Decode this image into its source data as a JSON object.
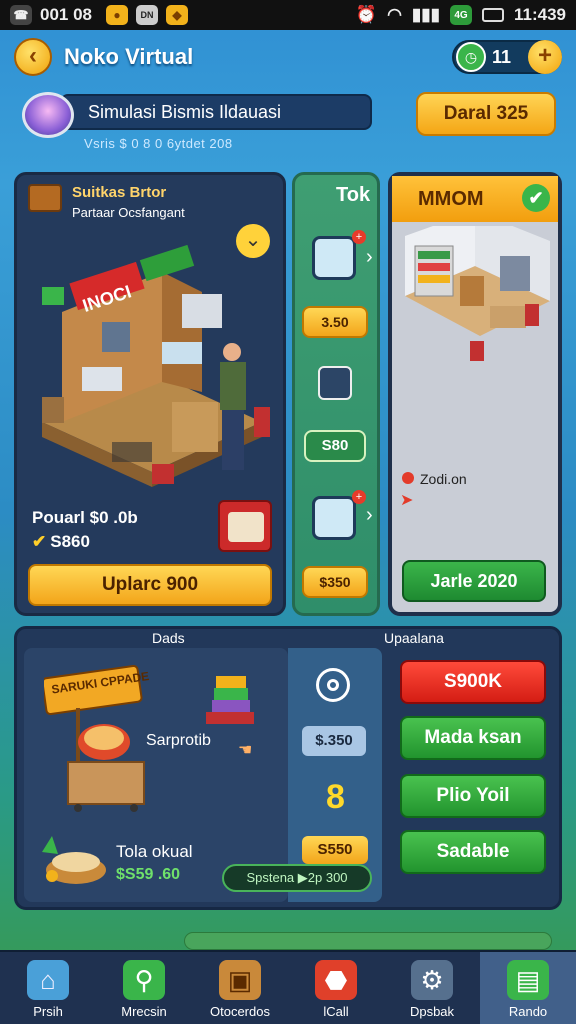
{
  "status_bar": {
    "time_left": "001 08",
    "time_right": "11:439",
    "signal": "4G"
  },
  "header": {
    "title": "Noko Virtual",
    "coin_value": "11",
    "back_glyph": "‹",
    "plus_glyph": "+"
  },
  "subheader": {
    "title": "Simulasi Bismis Ildauasi",
    "subtitle": "Vsris $ 0 8 0 6ytdet 208",
    "button": "Daral 325"
  },
  "panel_left": {
    "title": "Suitkas Brtor",
    "subtitle": "Partaar Ocsfangant",
    "store_sign": "INOCI",
    "price_label": "Pouarl $0 .0b",
    "check_value": "S860",
    "upgrade_button": "Uplarc 900"
  },
  "panel_mid": {
    "title": "Tok",
    "price_1": "3.50",
    "chip": "S80",
    "price_2": "$350"
  },
  "panel_right": {
    "header": "MMOM",
    "note": "Zodi.on",
    "button": "Jarle 2020"
  },
  "lower": {
    "left_label": "Dads",
    "right_label": "Upaalana",
    "cart_sign": "SARUKI CPPADE",
    "item_label": "Sarprotib",
    "total_label": "Tola okual",
    "total_value": "$S59 .60",
    "system_pill": "Spstena ▶2p 300",
    "price_small": "$.350",
    "counter": "8",
    "price_gold": "S550",
    "buttons": [
      "S900K",
      "Mada ksan",
      "Plio Yoil",
      "Sadable"
    ]
  },
  "nav": [
    {
      "label": "Prsih",
      "icon": "home-icon"
    },
    {
      "label": "Mrecsin",
      "icon": "magnifier-icon"
    },
    {
      "label": "Otocerdos",
      "icon": "box-icon"
    },
    {
      "label": "lCall",
      "icon": "octagon-icon"
    },
    {
      "label": "Dpsbak",
      "icon": "gear-icon"
    },
    {
      "label": "Rando",
      "icon": "clipboard-icon",
      "active": true
    }
  ],
  "colors": {
    "gold": "#f3a51a",
    "green": "#22942e",
    "red": "#d41d14",
    "panel": "#243a5c"
  }
}
